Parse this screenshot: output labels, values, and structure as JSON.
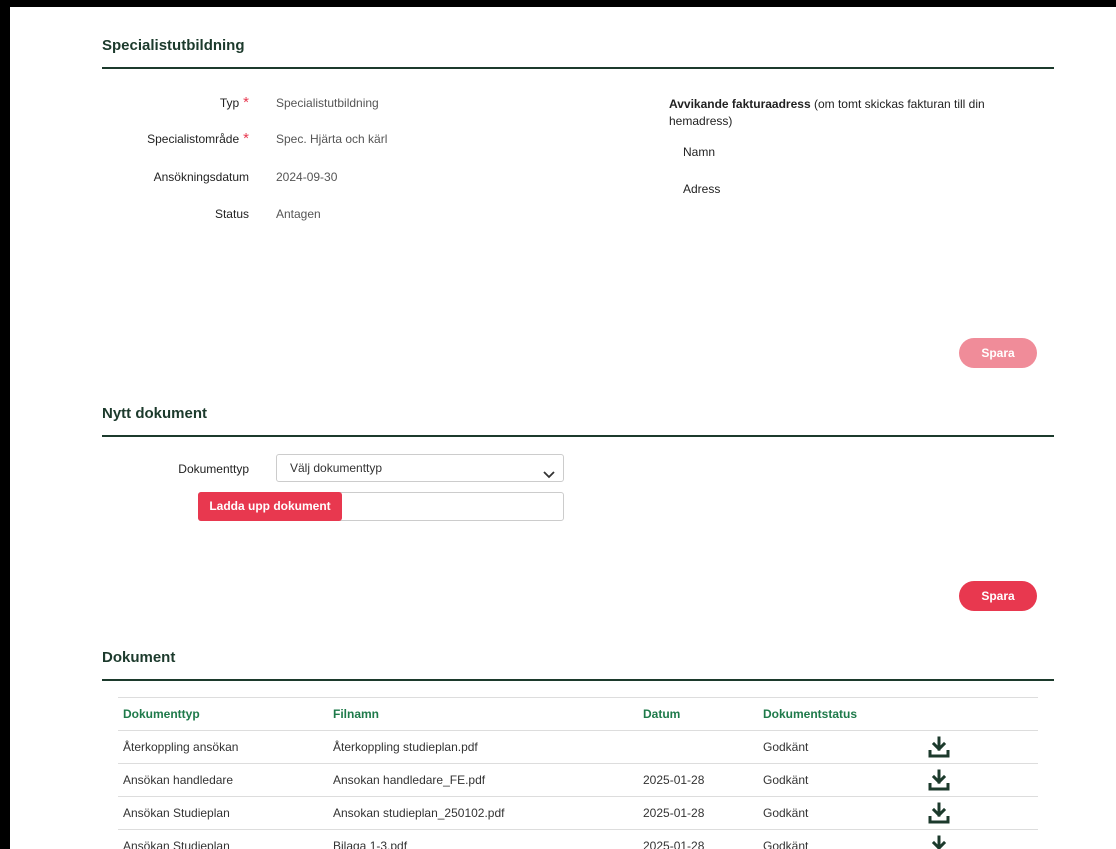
{
  "section1": {
    "title": "Specialistutbildning",
    "fields": [
      {
        "label": "Typ",
        "required": "*",
        "value": "Specialistutbildning"
      },
      {
        "label": "Specialistområde",
        "required": "*",
        "value": "Spec. Hjärta och kärl"
      },
      {
        "label": "Ansökningsdatum",
        "required": "",
        "value": "2024-09-30"
      },
      {
        "label": "Status",
        "required": "",
        "value": "Antagen"
      }
    ],
    "invoice": {
      "heading": "Avvikande fakturaadress",
      "note": " (om tomt skickas fakturan till din hemadress)",
      "name_label": "Namn",
      "address_label": "Adress"
    },
    "save_label": "Spara"
  },
  "section2": {
    "title": "Nytt dokument",
    "doctype_label": "Dokumenttyp",
    "doctype_selected": "Välj dokumenttyp",
    "upload_label": "Ladda upp dokument",
    "save_label": "Spara"
  },
  "section3": {
    "title": "Dokument",
    "columns": [
      "Dokumenttyp",
      "Filnamn",
      "Datum",
      "Dokumentstatus"
    ],
    "rows": [
      [
        "Återkoppling ansökan",
        "Återkoppling studieplan.pdf",
        "",
        "Godkänt"
      ],
      [
        "Ansökan handledare",
        "Ansokan handledare_FE.pdf",
        "2025-01-28",
        "Godkänt"
      ],
      [
        "Ansökan Studieplan",
        "Ansokan studieplan_250102.pdf",
        "2025-01-28",
        "Godkänt"
      ],
      [
        "Ansökan Studieplan",
        "Bilaga 1-3.pdf",
        "2025-01-28",
        "Godkänt"
      ]
    ],
    "row_icon": "download-icon"
  },
  "colors": {
    "dark_green": "#1c3a2c",
    "header_green": "#1e7a4a",
    "accent_red": "#e8384f",
    "disabled_red": "#f08c99"
  }
}
